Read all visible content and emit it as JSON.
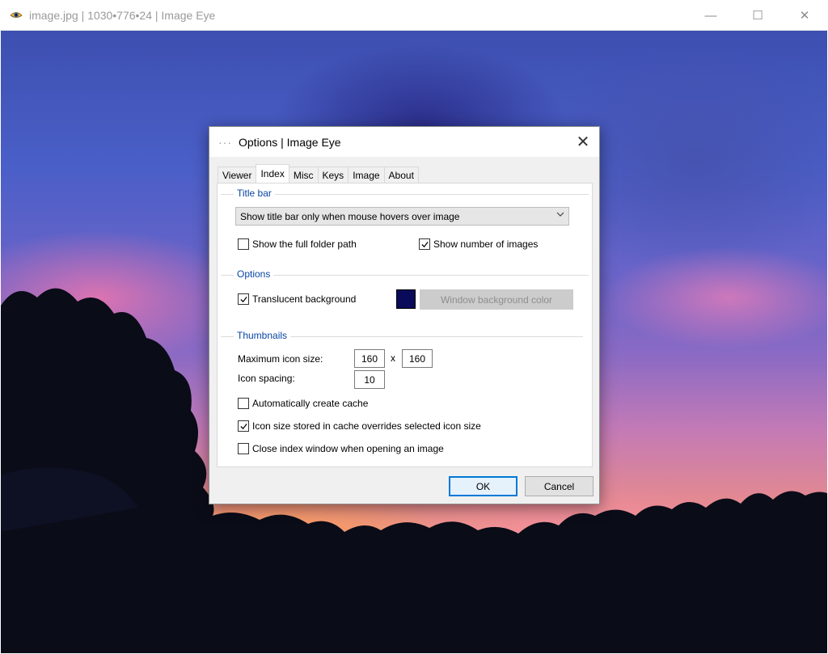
{
  "window": {
    "title": "image.jpg | 1030•776•24 | Image Eye",
    "controls": {
      "minimize": "—",
      "maximize": "☐",
      "close": "✕"
    }
  },
  "dialog": {
    "sysmenu": "···",
    "title": "Options | Image Eye",
    "close": "✕",
    "tabs": [
      {
        "label": "Viewer",
        "active": false
      },
      {
        "label": "Index",
        "active": true
      },
      {
        "label": "Misc",
        "active": false
      },
      {
        "label": "Keys",
        "active": false
      },
      {
        "label": "Image",
        "active": false
      },
      {
        "label": "About",
        "active": false
      }
    ],
    "title_bar_group": {
      "label": "Title bar",
      "combo_value": "Show title bar only when mouse hovers over image",
      "show_full_folder_path": {
        "label": "Show the full folder path",
        "checked": false
      },
      "show_number_of_images": {
        "label": "Show number of images",
        "checked": true
      }
    },
    "options_group": {
      "label": "Options",
      "translucent_background": {
        "label": "Translucent background",
        "checked": true
      },
      "swatch_color": "#0a0a5a",
      "window_bg_button": "Window background color"
    },
    "thumbnails_group": {
      "label": "Thumbnails",
      "max_icon_size_label": "Maximum icon size:",
      "max_icon_width": "160",
      "times": "x",
      "max_icon_height": "160",
      "icon_spacing_label": "Icon spacing:",
      "icon_spacing": "10",
      "auto_cache": {
        "label": "Automatically create cache",
        "checked": false
      },
      "cache_overrides": {
        "label": "Icon size stored in cache overrides selected icon size",
        "checked": true
      },
      "close_index": {
        "label": "Close index window when opening an image",
        "checked": false
      }
    },
    "ok_label": "OK",
    "cancel_label": "Cancel"
  },
  "colors": {
    "accent": "#0078d7",
    "group_label": "#0a46a5"
  }
}
